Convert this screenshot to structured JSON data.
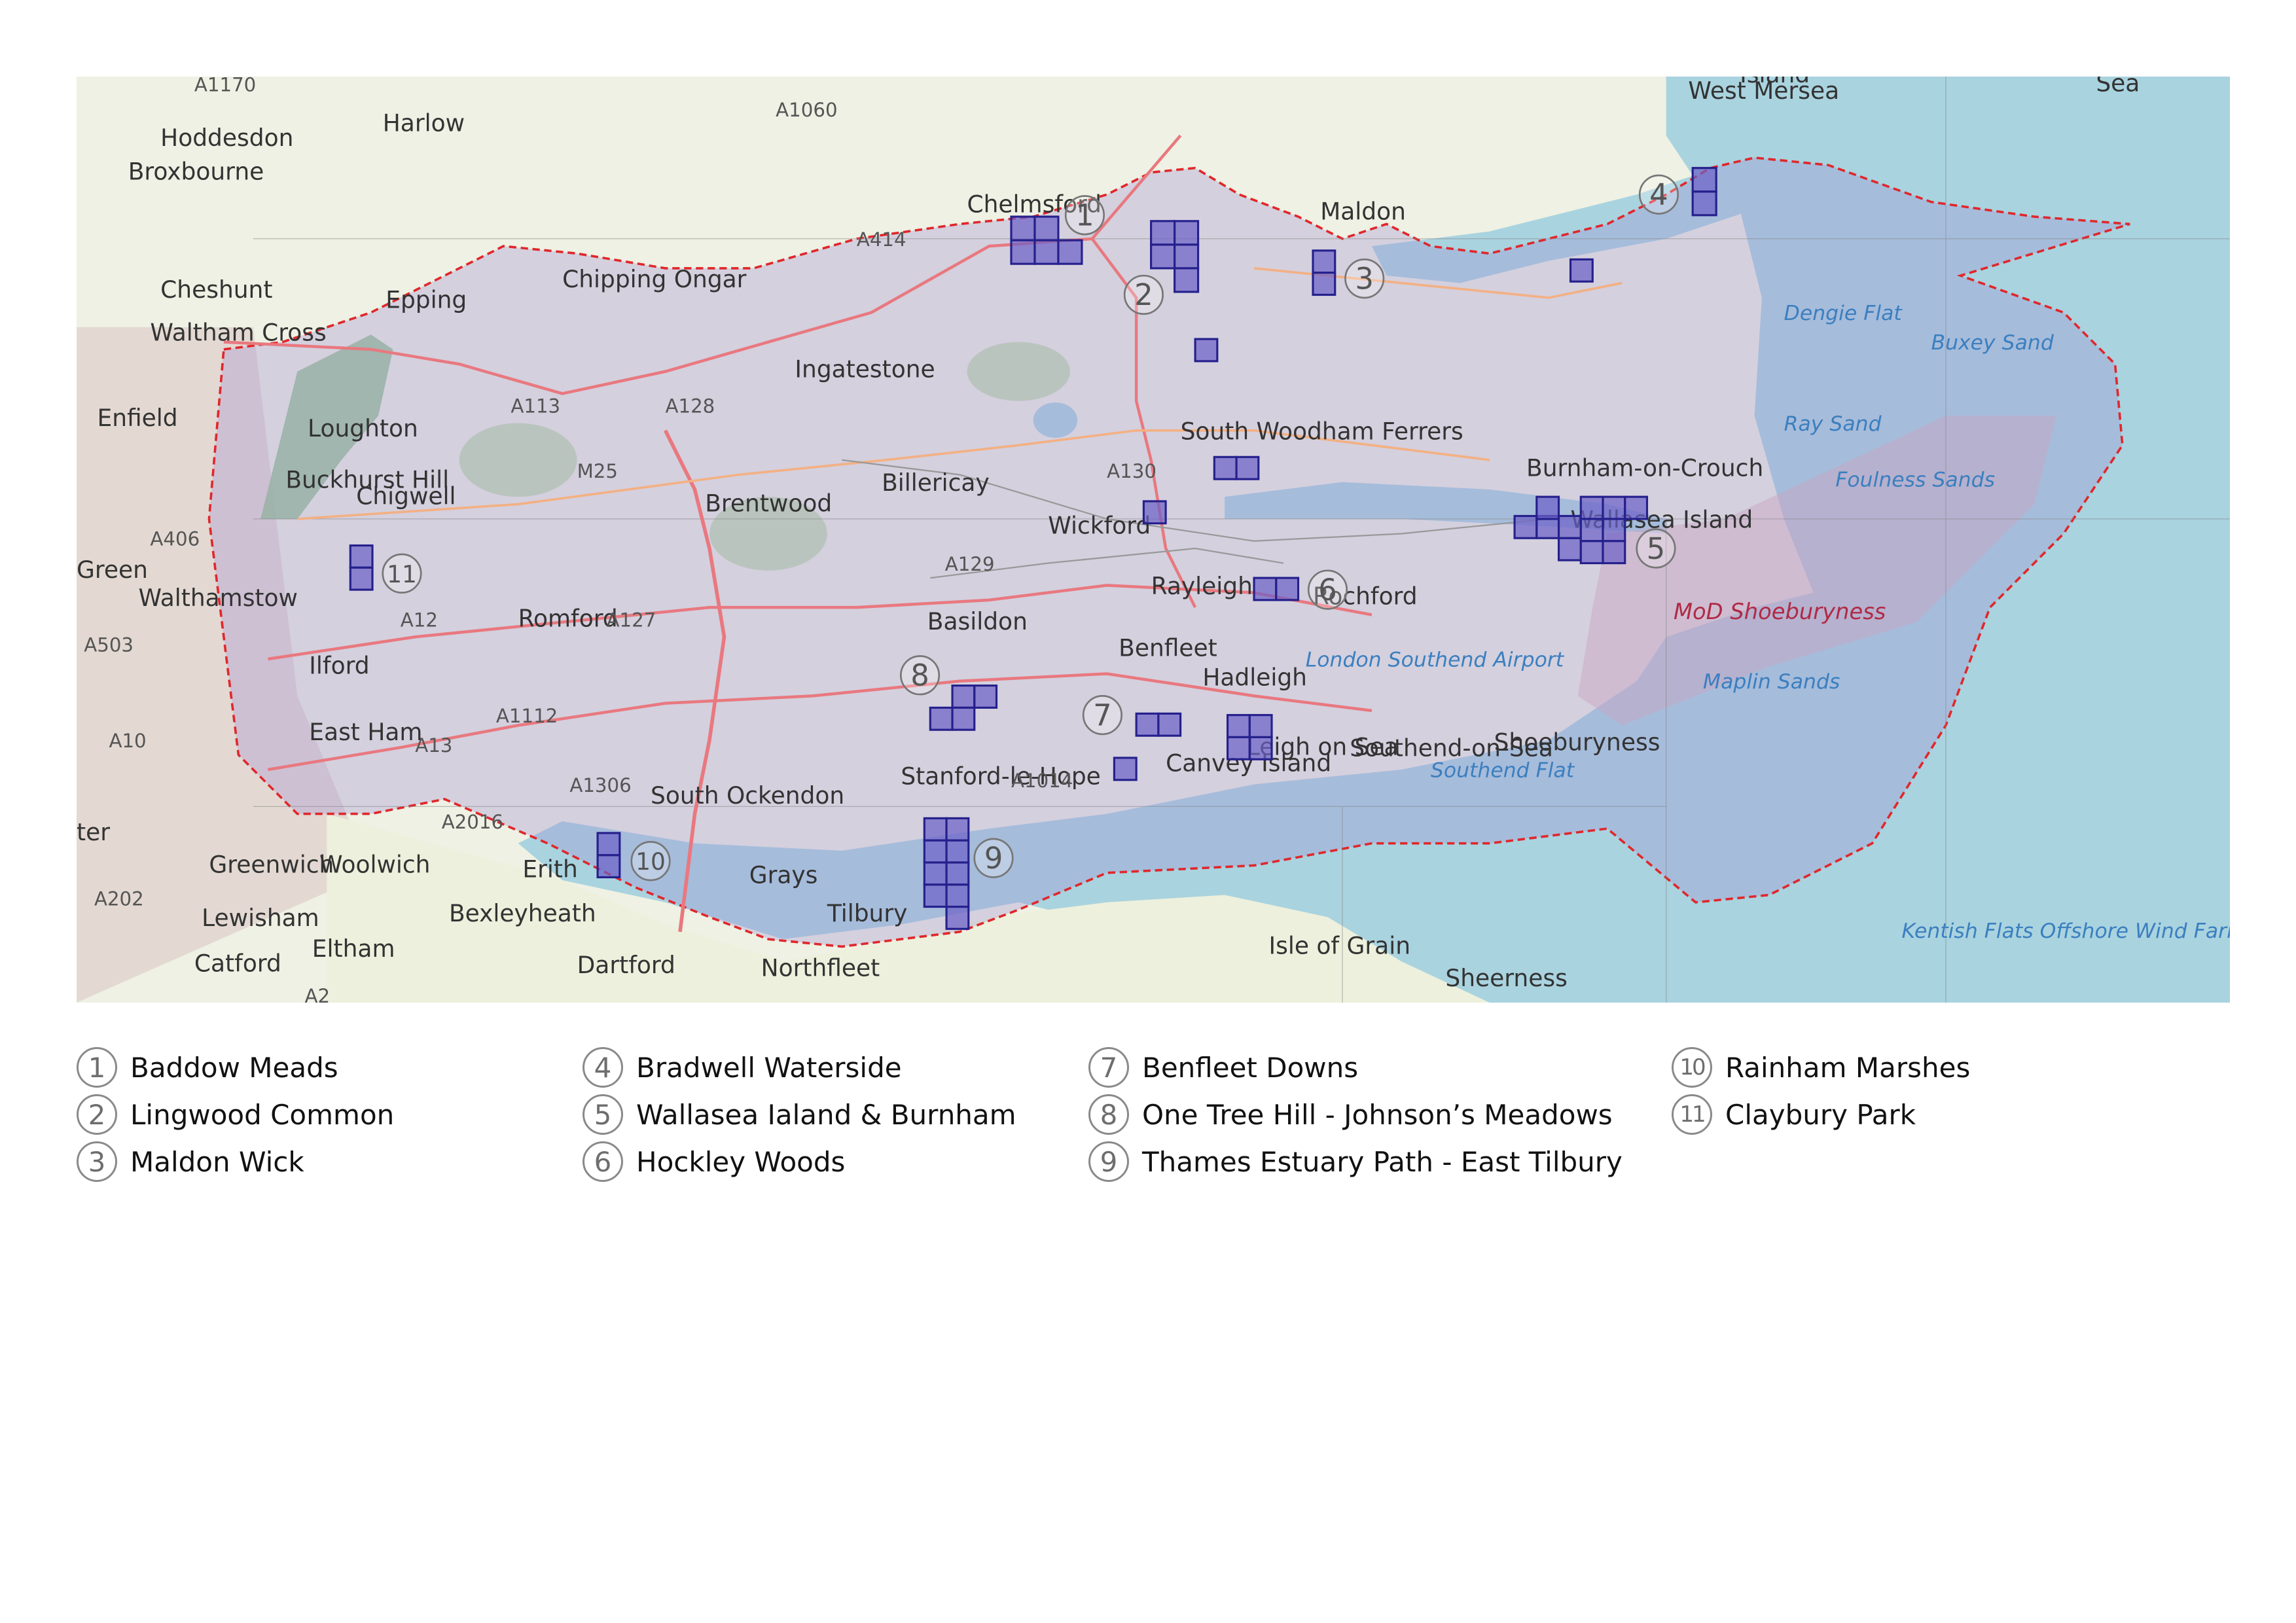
{
  "map": {
    "colors": {
      "land": "#eef1e3",
      "sea": "#a9d3df",
      "study_area_fill": "#a08ed6",
      "study_area_border": "#e0272b",
      "site_fill": "#6b5fc8",
      "site_border": "#25208c",
      "forest": "#8fc08a",
      "road_main": "#e9787f",
      "road_secondary": "#f3b083"
    },
    "place_labels": [
      "Harlow",
      "Hoddesdon",
      "Broxbourne",
      "Cheshunt",
      "Waltham Cross",
      "Epping",
      "Chelmsford",
      "Chipping Ongar",
      "Maldon",
      "West Mersea",
      "Enfield",
      "Loughton",
      "Buckhurst Hill",
      "Chigwell",
      "Ingatestone",
      "Billericay",
      "Brentwood",
      "Wickford",
      "South Woodham Ferrers",
      "Burnham-on-Crouch",
      "Wallasea Island",
      "Rayleigh",
      "Rochford",
      "Romford",
      "Walthamstow",
      "Ilford",
      "Basildon",
      "Benfleet",
      "Hadleigh",
      "London Southend Airport",
      "Leigh on Sea",
      "Southend-on-Sea",
      "Shoeburyness",
      "East Ham",
      "Canvey Island",
      "Stanford-le-Hope",
      "South Ockendon",
      "Greenwich",
      "Woolwich",
      "Erith",
      "Bexleyheath",
      "Grays",
      "Tilbury",
      "Lewisham",
      "Eltham",
      "Dartford",
      "Catford",
      "Northfleet",
      "Isle of Grain",
      "Sheerness",
      "Green",
      "ter",
      "Foulness Sands",
      "Maplin Sands",
      "Dengie Flat",
      "Buxey Sand",
      "Ray Sand",
      "Southend Flat",
      "Kentish Flats Offshore Wind Farm",
      "Sea",
      "Island"
    ],
    "road_labels": [
      "A1170",
      "A1060",
      "A414",
      "A113",
      "A128",
      "M25",
      "A130",
      "A129",
      "A12",
      "A127",
      "A406",
      "A503",
      "A10",
      "A13",
      "A1112",
      "A1306",
      "A2016",
      "A1014",
      "A202",
      "A2"
    ],
    "restricted_area_label": "MoD Shoeburyness",
    "site_markers": [
      "1",
      "2",
      "3",
      "4",
      "5",
      "6",
      "7",
      "8",
      "9",
      "10",
      "11"
    ]
  },
  "legend": {
    "items": [
      {
        "num": "1",
        "label": "Baddow Meads"
      },
      {
        "num": "2",
        "label": "Lingwood Common"
      },
      {
        "num": "3",
        "label": "Maldon Wick"
      },
      {
        "num": "4",
        "label": "Bradwell Waterside"
      },
      {
        "num": "5",
        "label": "Wallasea Ialand & Burnham"
      },
      {
        "num": "6",
        "label": "Hockley Woods"
      },
      {
        "num": "7",
        "label": "Benfleet Downs"
      },
      {
        "num": "8",
        "label": "One Tree Hill - Johnson’s Meadows"
      },
      {
        "num": "9",
        "label": "Thames Estuary Path - East Tilbury"
      },
      {
        "num": "10",
        "label": "Rainham Marshes"
      },
      {
        "num": "11",
        "label": "Claybury Park"
      }
    ]
  }
}
